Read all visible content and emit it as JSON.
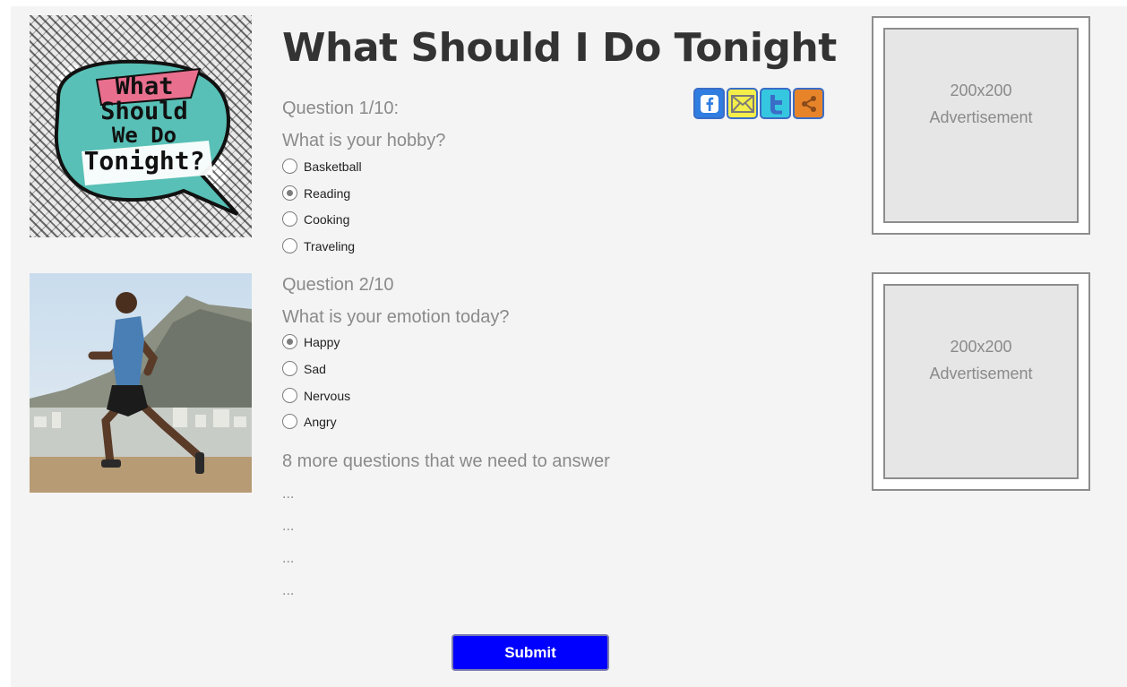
{
  "page": {
    "title": "What Should I Do Tonight"
  },
  "logo": {
    "line1": "What",
    "line2": "Should",
    "line3": "We Do",
    "line4": "Tonight?"
  },
  "share": {
    "icons": [
      "facebook-icon",
      "email-icon",
      "twitter-icon",
      "share-icon"
    ],
    "colors": [
      "#2f7de1",
      "#f3ee4a",
      "#35c7e0",
      "#e7842a"
    ]
  },
  "questions": [
    {
      "number": "Question 1/10:",
      "text": "What is your hobby?",
      "options": [
        "Basketball",
        "Reading",
        "Cooking",
        "Traveling"
      ],
      "selected": "Reading"
    },
    {
      "number": "Question 2/10",
      "text": "What is your emotion today?",
      "options": [
        "Happy",
        "Sad",
        "Nervous",
        "Angry"
      ],
      "selected": "Happy"
    }
  ],
  "more": {
    "text": "8 more questions that we need to answer",
    "ellipses": [
      "...",
      "...",
      "...",
      "..."
    ]
  },
  "ads": [
    {
      "size": "200x200",
      "label": "Advertisement"
    },
    {
      "size": "200x200",
      "label": "Advertisement"
    }
  ],
  "submit": {
    "label": "Submit",
    "color": "#0000ff"
  }
}
